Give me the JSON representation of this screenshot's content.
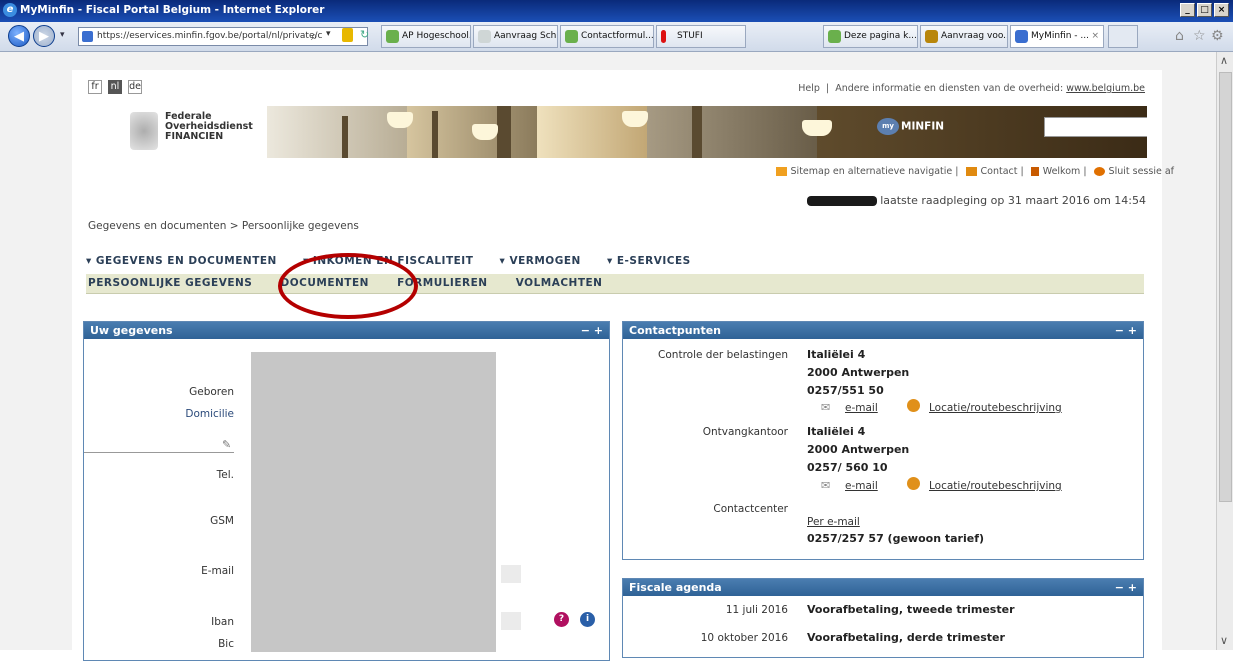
{
  "window": {
    "title": "MyMinfin - Fiscal Portal Belgium - Internet Explorer",
    "controls": [
      "_",
      "□",
      "×"
    ]
  },
  "browser": {
    "address": "https://eservices.minfin.fgov.be/portal/nl/private/c",
    "tabs": [
      {
        "label": "AP Hogeschool...",
        "color": "#6ab04c"
      },
      {
        "label": "Aanvraag Sch...",
        "color": "#9aa"
      },
      {
        "label": "Contactformul...",
        "color": "#6ab04c"
      },
      {
        "label": "STUFI",
        "color": "#d11"
      },
      {
        "label": "Deze pagina k...",
        "color": "#6ab04c"
      },
      {
        "label": "Aanvraag voo...",
        "color": "#b8860b"
      },
      {
        "label": "MyMinfin - ...",
        "color": "#3a6ed0",
        "active": true
      }
    ]
  },
  "header": {
    "languages": [
      "fr",
      "nl",
      "de"
    ],
    "help": "Help",
    "other_info": "Andere informatie en diensten van de overheid:",
    "other_link": "www.belgium.be",
    "org_line1": "Federale",
    "org_line2": "Overheidsdienst",
    "org_line3": "FINANCIEN",
    "brand": "MINFIN",
    "brand_prefix": "my",
    "sitemap": "Sitemap en alternatieve navigatie",
    "contact": "Contact",
    "welcome": "Welkom",
    "logout": "Sluit sessie af",
    "last_visit": "laatste raadpleging op 31 maart 2016 om 14:54"
  },
  "breadcrumb": "Gegevens en documenten > Persoonlijke gegevens",
  "menu_main": [
    "▾ GEGEVENS EN DOCUMENTEN",
    "▾ INKOMEN EN FISCALITEIT",
    "▾ VERMOGEN",
    "▾ E-SERVICES"
  ],
  "menu_sub": [
    "PERSOONLIJKE GEGEVENS",
    "DOCUMENTEN",
    "FORMULIEREN",
    "VOLMACHTEN"
  ],
  "panel_left": {
    "title": "Uw gegevens",
    "controls": "− +",
    "fields": [
      "Geboren",
      "Domicilie",
      "Tel.",
      "GSM",
      "E-mail",
      "Iban",
      "Bic"
    ]
  },
  "panel_contact": {
    "title": "Contactpunten",
    "controls": "− +",
    "c1_label": "Controle der belastingen",
    "c1_street": "Italiëlei 4",
    "c1_city": "2000 Antwerpen",
    "c1_phone": "0257/551 50",
    "c2_label": "Ontvangkantoor",
    "c2_street": "Italiëlei 4",
    "c2_city": "2000 Antwerpen",
    "c2_phone": "0257/ 560 10",
    "email": "e-mail",
    "route": "Locatie/routebeschrijving",
    "c3_label": "Contactcenter",
    "c3_email": "Per e-mail",
    "c3_phone": "0257/257 57 (gewoon tarief)"
  },
  "panel_agenda": {
    "title": "Fiscale agenda",
    "controls": "− +",
    "items": [
      {
        "date": "11 juli 2016",
        "text": "Voorafbetaling, tweede trimester"
      },
      {
        "date": "10 oktober 2016",
        "text": "Voorafbetaling, derde trimester"
      }
    ]
  }
}
